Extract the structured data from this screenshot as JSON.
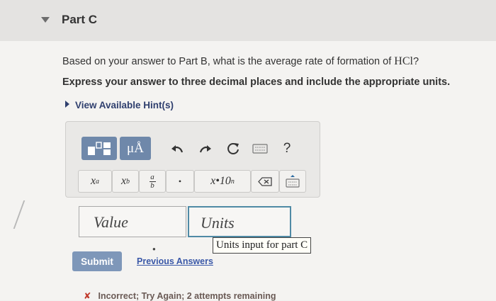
{
  "part": {
    "title": "Part C"
  },
  "question": {
    "text_prefix": "Based on your answer to Part B, what is the average rate of formation of ",
    "species": "HCl",
    "text_suffix": "?",
    "instruction": "Express your answer to three decimal places and include the appropriate units."
  },
  "hints": {
    "label": "View Available Hint(s)"
  },
  "toolbar": {
    "units_label": "μÅ",
    "help_label": "?"
  },
  "symbols": {
    "superscript_base": "x",
    "superscript_exp": "a",
    "subscript_base": "x",
    "subscript_sub": "b",
    "fraction_num": "a",
    "fraction_den": "b",
    "dot": "•",
    "sci_notation": "x•10",
    "sci_exp": "n"
  },
  "inputs": {
    "value_placeholder": "Value",
    "units_placeholder": "Units",
    "units_tooltip": "Units input for part C"
  },
  "actions": {
    "submit": "Submit",
    "previous_answers": "Previous Answers"
  },
  "feedback": {
    "text": "Incorrect; Try Again; 2 attempts remaining"
  },
  "colors": {
    "toolbar_button": "#6f88aa",
    "submit_button": "#7e97b9",
    "link": "#3a58a8",
    "units_focus_border": "#4f8aa5",
    "error": "#c0392b"
  }
}
